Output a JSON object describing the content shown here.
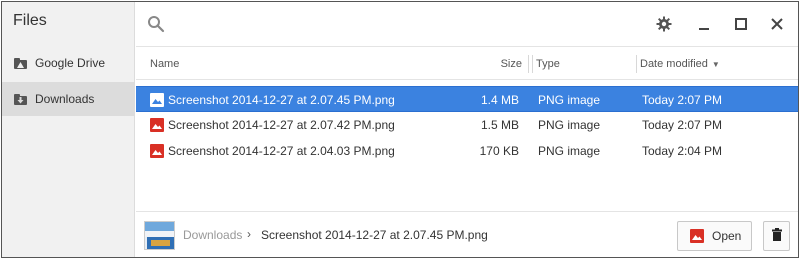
{
  "app": {
    "title": "Files"
  },
  "sidebar": {
    "items": [
      {
        "label": "Google Drive",
        "icon": "google-drive-folder-icon"
      },
      {
        "label": "Downloads",
        "icon": "downloads-folder-icon",
        "selected": true
      }
    ]
  },
  "toolbar": {
    "icons": [
      "search-icon",
      "gear-icon",
      "minimize-icon",
      "maximize-icon",
      "close-icon"
    ]
  },
  "columns": {
    "name": "Name",
    "size": "Size",
    "type": "Type",
    "date": "Date modified",
    "sort": "descending"
  },
  "files": [
    {
      "name": "Screenshot 2014-12-27 at 2.07.45 PM.png",
      "size": "1.4 MB",
      "type": "PNG image",
      "date": "Today 2:07 PM",
      "selected": true
    },
    {
      "name": "Screenshot 2014-12-27 at 2.07.42 PM.png",
      "size": "1.5 MB",
      "type": "PNG image",
      "date": "Today 2:07 PM",
      "selected": false
    },
    {
      "name": "Screenshot 2014-12-27 at 2.04.03 PM.png",
      "size": "170 KB",
      "type": "PNG image",
      "date": "Today 2:04 PM",
      "selected": false
    }
  ],
  "footer": {
    "breadcrumb_root": "Downloads",
    "breadcrumb_separator": "›",
    "breadcrumb_file": "Screenshot 2014-12-27 at 2.07.45 PM.png",
    "open_label": "Open"
  },
  "colors": {
    "selection": "#3b82e0",
    "image_icon": "#d93025",
    "sidebar_bg": "#f1f1f1",
    "sidebar_selected": "#dcdcdc"
  }
}
